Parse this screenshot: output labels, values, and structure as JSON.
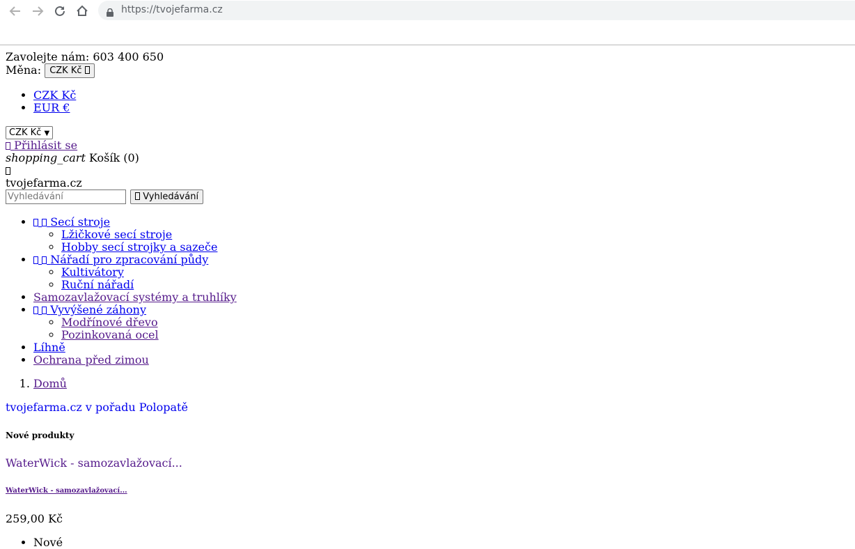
{
  "browser": {
    "url": "https://tvojefarma.cz"
  },
  "header": {
    "phone_label": "Zavolejte nám: 603 400 650",
    "currency_label": "Měna:",
    "currency_button": "CZK Kč",
    "currency_options": [
      "CZK Kč",
      "EUR €"
    ],
    "currency_select": "CZK Kč",
    "login": "Přihlásit se",
    "cart_icon_text": "shopping_cart",
    "cart_label": "Košík (0)",
    "logo_alt": "tvojefarma.cz",
    "search_placeholder": "Vyhledávání",
    "search_button": "Vyhledávání"
  },
  "menu": {
    "sec_stroje": "Secí stroje",
    "sec_sub1": "Lžičkové secí stroje",
    "sec_sub2": "Hobby secí strojky a sazeče",
    "naradi": "Nářadí pro zpracování půdy",
    "naradi_sub1": "Kultivátory",
    "naradi_sub2": "Ruční nářadí",
    "samozavlazovaci": "Samozavlažovací systémy a truhlíky",
    "zahony": "Vyvýšené záhony",
    "zahony_sub1": "Modřínové dřevo",
    "zahony_sub2": "Pozinkovaná ocel",
    "lihne": "Líhně",
    "ochrana": "Ochrana před zimou"
  },
  "breadcrumb": {
    "home": "Domů"
  },
  "banner": {
    "alt": "tvojefarma.cz v pořadu Polopatě"
  },
  "new_products": {
    "heading": "Nové produkty",
    "product_image_alt": "WaterWick - samozavlažovací...",
    "product_name": "WaterWick - samozavlažovací...",
    "price": "259,00 Kč",
    "badge": "Nové"
  },
  "colors": {
    "link": "#0000ee",
    "visited": "#551a8b"
  }
}
